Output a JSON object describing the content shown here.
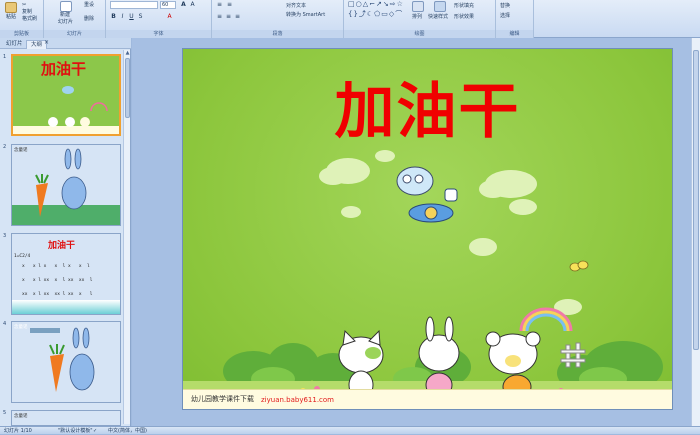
{
  "ribbon": {
    "groups": {
      "clipboard": "剪贴板",
      "slides": "幻灯片",
      "font": "字体",
      "paragraph": "段落",
      "drawing": "绘图",
      "editing": "编辑"
    },
    "buttons": {
      "paste": "粘贴",
      "copy": "复制",
      "format_painter": "格式刷",
      "new_slide": "新建",
      "new_slide_sub": "幻灯片",
      "reset": "重设",
      "delete": "删除",
      "font_size": "60",
      "align_text": "对齐文本",
      "convert_smartart": "转换为 SmartArt",
      "arrange": "排列",
      "quick_styles": "快速样式",
      "shape_fill": "形状填充",
      "shape_effects": "形状效果",
      "replace": "替换",
      "select": "选择"
    }
  },
  "panel": {
    "tabs": [
      "幻灯片",
      "大纲"
    ],
    "close": "×",
    "slides": [
      {
        "num": "1",
        "title": "加油干"
      },
      {
        "num": "2",
        "title": "念童谣"
      },
      {
        "num": "3",
        "title": "加油干",
        "meter": "1=C2/4",
        "rows": [
          "x   x l x   x  l x   x  l",
          "x   x l xx  x  l xx  xx  l",
          "xx  x l xx  xx l xx  x   l"
        ]
      },
      {
        "num": "4",
        "title": "念童谣"
      },
      {
        "num": "5",
        "title": "念童谣"
      }
    ]
  },
  "slide": {
    "title": "加油干",
    "footer_text": "幼儿园教学课件下载",
    "footer_url": "ziyuan.baby611.com"
  },
  "statusbar": {
    "slide_info": "幻灯片 1/10",
    "theme": "\"默认设计模板\"",
    "language": "中文(简体，中国)"
  },
  "colors": {
    "slide_bg": "#8cc63c",
    "title_red": "#f00000",
    "ribbon_blue": "#c9daf2"
  }
}
